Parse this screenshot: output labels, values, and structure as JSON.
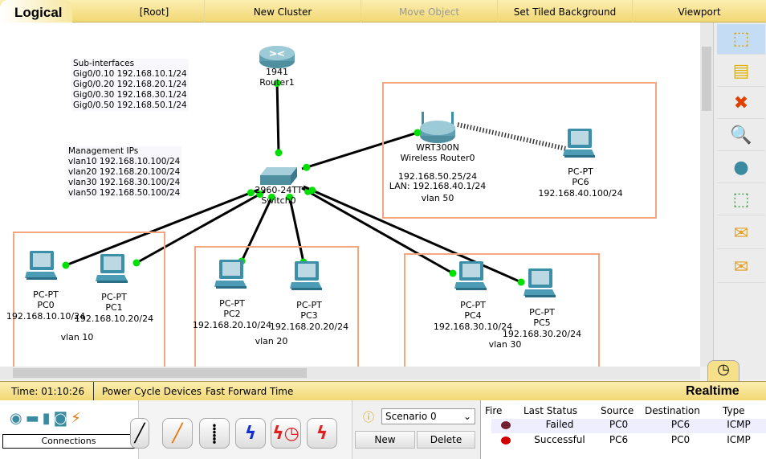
{
  "topbar": {
    "mode": "Logical",
    "items": [
      "[Root]",
      "New Cluster",
      "Move Object",
      "Set Tiled Background",
      "Viewport"
    ]
  },
  "notes": {
    "subinterfaces": "Sub-interfaces\nGig0/0.10 192.168.10.1/24\nGig0/0.20 192.168.20.1/24\nGig0/0.30 192.168.30.1/24\nGig0/0.50 192.168.50.1/24",
    "management": "Management IPs\nvlan10 192.168.10.100/24\nvlan20 192.168.20.100/24\nvlan30 192.168.30.100/24\nvlan50 192.168.50.100/24"
  },
  "devices": {
    "router1": {
      "model": "1941",
      "name": "Router1"
    },
    "switch0": {
      "model": "2960-24TT",
      "name": "Switch0"
    },
    "wrt": {
      "model": "WRT300N",
      "name": "Wireless Router0",
      "ip": "192.168.50.25/24",
      "lan": "LAN: 192.168.40.1/24"
    },
    "pc0": {
      "model": "PC-PT",
      "name": "PC0",
      "ip": "192.168.10.10/24"
    },
    "pc1": {
      "model": "PC-PT",
      "name": "PC1",
      "ip": "192.168.10.20/24"
    },
    "pc2": {
      "model": "PC-PT",
      "name": "PC2",
      "ip": "192.168.20.10/24"
    },
    "pc3": {
      "model": "PC-PT",
      "name": "PC3",
      "ip": "192.168.20.20/24"
    },
    "pc4": {
      "model": "PC-PT",
      "name": "PC4",
      "ip": "192.168.30.10/24"
    },
    "pc5": {
      "model": "PC-PT",
      "name": "PC5",
      "ip": "192.168.30.20/24"
    },
    "pc6": {
      "model": "PC-PT",
      "name": "PC6",
      "ip": "192.168.40.100/24"
    }
  },
  "vlans": {
    "v10": "vlan 10",
    "v20": "vlan 20",
    "v30": "vlan 30",
    "v50": "vlan 50"
  },
  "colors": {
    "link_up": "#00e000",
    "vlan_box": "#f4a77e",
    "toolbar": "#f2d874"
  },
  "status": {
    "time": "Time: 01:10:26",
    "power_cycle": "Power Cycle Devices",
    "fast_forward": "Fast Forward Time",
    "mode": "Realtime"
  },
  "bottom": {
    "category_label": "Connections",
    "scenario": "Scenario 0",
    "new": "New",
    "delete": "Delete",
    "pdu_headers": [
      "Fire",
      "Last Status",
      "Source",
      "Destination",
      "Type"
    ],
    "pdu_rows": [
      {
        "status": "Failed",
        "source": "PC0",
        "destination": "PC6",
        "type": "ICMP"
      },
      {
        "status": "Successful",
        "source": "PC6",
        "destination": "PC0",
        "type": "ICMP"
      }
    ]
  }
}
